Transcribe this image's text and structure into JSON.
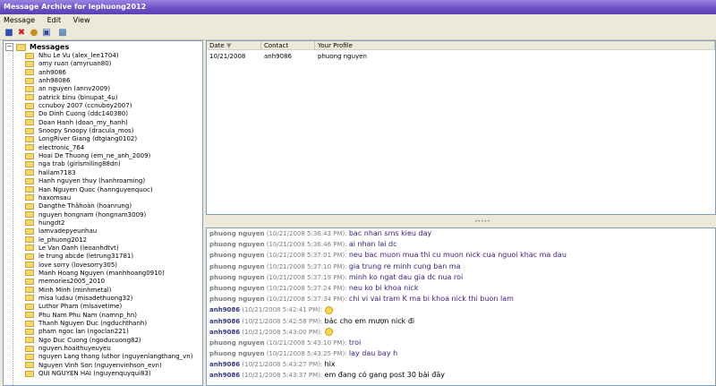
{
  "window": {
    "title": "Message Archive for lephuong2012"
  },
  "menu": [
    "Message",
    "Edit",
    "View"
  ],
  "toolbar": {
    "icons": [
      "save-icon",
      "delete-icon",
      "find-icon",
      "print-icon",
      "export-icon"
    ]
  },
  "tree": {
    "root_label": "Messages",
    "items": [
      "Nhu Le Vu (alex_lee1704)",
      "amy ruan (amyruan80)",
      "anh9086",
      "anh98086",
      "an nguyen (annv2009)",
      "patrick binu (binupat_4u)",
      "ccnuboy 2007 (ccnuboy2007)",
      "Do Dinh Cuong (ddc140380)",
      "Doan Hanh (doan_my_hanh)",
      "Snoopy Snoopy (dracula_mos)",
      "LongRiver Giang (dtgiang0102)",
      "electronic_764",
      "Hoai De Thuong (em_ne_anh_2009)",
      "nga trab (girlsmiling88dn)",
      "hailam7183",
      "Hanh nguyen thuy (hanhroaming)",
      "Han Nguyen Quoc (hannguyenquoc)",
      "haxomsau",
      "Dangthe Thâhoàn (hoanrung)",
      "nguyen hongnam (hongnam3009)",
      "hungdt2",
      "lamvadepyeunhau",
      "le_phuong2012",
      "Le Van Oanh (leoanhdtvt)",
      "le trung abcde (letrung31781)",
      "love sorry (lovesorry305)",
      "Manh Hoang Nguyen (manhhoang0910)",
      "memories2005_2010",
      "Minh Minh (minhmetal)",
      "misa ludau (misadethuong32)",
      "Luthor Pham (misavetime)",
      "Phu Nam Phu Nam (namnp_hn)",
      "Thanh Nguyen Duc (ngduchthanh)",
      "pham ngoc lan (ngoclan221)",
      "Ngo Duc Cuong (ngoducuong82)",
      "nguyen.hoaithuyeuyeu",
      "nguyen Lang thang luthor (nguyenlangthang_vn)",
      "Nguyen Vinh Son (nguyenvinhson_evn)",
      "QUI NGUYEN HAI (nguyenquyqui83)"
    ]
  },
  "list": {
    "columns": [
      "Date",
      "Contact",
      "Your Profile"
    ],
    "rows": [
      {
        "date": "10/21/2008",
        "contact": "anh9086",
        "profile": "phuong nguyen"
      }
    ]
  },
  "messages": [
    {
      "who": "phuong nguyen",
      "time": "(10/21/2008 5:36:43 PM):",
      "text": "bac nhan sms kieu day",
      "self": false,
      "emoticon": false
    },
    {
      "who": "phuong nguyen",
      "time": "(10/21/2008 5:36:46 PM):",
      "text": "ai nhan lai dc",
      "self": false,
      "emoticon": false
    },
    {
      "who": "phuong nguyen",
      "time": "(10/21/2008 5:37:01 PM):",
      "text": "neu bac muon mua thi cu muon nick cua nguoi khac ma dau",
      "self": false,
      "emoticon": false
    },
    {
      "who": "phuong nguyen",
      "time": "(10/21/2008 5:37:10 PM):",
      "text": "gia trung re minh cung ban ma",
      "self": false,
      "emoticon": false
    },
    {
      "who": "phuong nguyen",
      "time": "(10/21/2008 5:37:19 PM):",
      "text": "minh ko ngat dau gia dc nua roi",
      "self": false,
      "emoticon": false
    },
    {
      "who": "phuong nguyen",
      "time": "(10/21/2008 5:37:24 PM):",
      "text": "neu ko bi khoa nick",
      "self": false,
      "emoticon": false
    },
    {
      "who": "phuong nguyen",
      "time": "(10/21/2008 5:37:34 PM):",
      "text": "chi vi vai tram K ma bi khoa nick thi buon lam",
      "self": false,
      "emoticon": false
    },
    {
      "who": "anh9086",
      "time": "(10/21/2008 5:42:41 PM):",
      "text": "",
      "self": true,
      "emoticon": true
    },
    {
      "who": "anh9086",
      "time": "(10/21/2008 5:42:58 PM):",
      "text": "bác cho em mượn nick đi",
      "self": true,
      "emoticon": false
    },
    {
      "who": "anh9086",
      "time": "(10/21/2008 5:43:00 PM):",
      "text": "",
      "self": true,
      "emoticon": true
    },
    {
      "who": "phuong nguyen",
      "time": "(10/21/2008 5:43:10 PM):",
      "text": "troi",
      "self": false,
      "emoticon": false
    },
    {
      "who": "phuong nguyen",
      "time": "(10/21/2008 5:43:25 PM):",
      "text": "lay dau bay h",
      "self": false,
      "emoticon": false
    },
    {
      "who": "anh9086",
      "time": "(10/21/2008 5:43:27 PM):",
      "text": "hix",
      "self": true,
      "emoticon": false
    },
    {
      "who": "anh9086",
      "time": "(10/21/2008 5:43:37 PM):",
      "text": "em đang có gang post 30 bài đây",
      "self": true,
      "emoticon": false
    }
  ]
}
